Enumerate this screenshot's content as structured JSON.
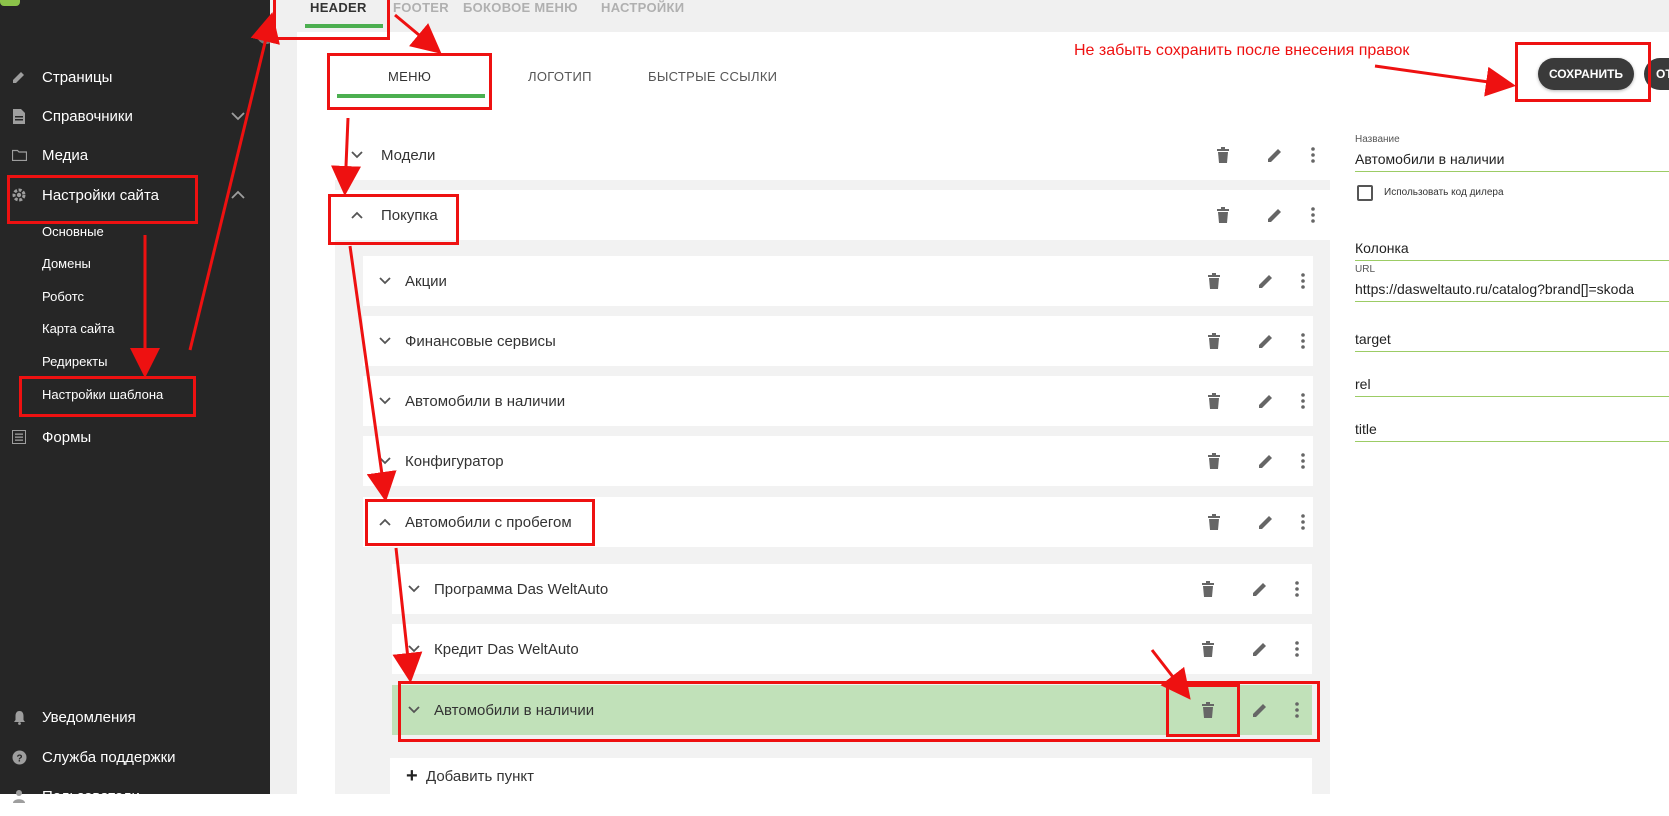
{
  "sidebar": {
    "items": [
      {
        "label": "Страницы",
        "icon": "pencil-icon"
      },
      {
        "label": "Справочники",
        "icon": "document-icon"
      },
      {
        "label": "Медиа",
        "icon": "folder-icon"
      },
      {
        "label": "Настройки сайта",
        "icon": "gear-icon"
      },
      {
        "label": "Формы",
        "icon": "list-icon"
      },
      {
        "label": "Уведомления",
        "icon": "bell-icon"
      },
      {
        "label": "Служба поддержки",
        "icon": "help-icon"
      },
      {
        "label": "Пользователи",
        "icon": "user-icon"
      }
    ],
    "subitems": [
      "Основные",
      "Домены",
      "Роботс",
      "Карта сайта",
      "Редиректы",
      "Настройки шаблона"
    ]
  },
  "top_tabs": [
    "HEADER",
    "FOOTER",
    "БОКОВОЕ МЕНЮ",
    "НАСТРОЙКИ"
  ],
  "inner_tabs": [
    "МЕНЮ",
    "ЛОГОТИП",
    "БЫСТРЫЕ ССЫЛКИ"
  ],
  "annotation_note": "Не забыть сохранить после внесения правок",
  "save_label": "СОХРАНИТЬ",
  "other_label": "ОТ",
  "menu": {
    "level1": [
      "Модели",
      "Покупка"
    ],
    "level2": [
      "Акции",
      "Финансовые сервисы",
      "Автомобили в наличии",
      "Конфигуратор",
      "Автомобили с пробегом"
    ],
    "level3": [
      "Программа Das WeltAuto",
      "Кредит Das WeltAuto",
      "Автомобили в наличии"
    ],
    "add_label": "Добавить пункт"
  },
  "form": {
    "name_label": "Название",
    "name_value": "Автомобили в наличии",
    "dealer_code_label": "Использовать код дилера",
    "column_value": "Колонка",
    "url_label": "URL",
    "url_value": "https://dasweltauto.ru/catalog?brand[]=skoda",
    "target_value": "target",
    "rel_value": "rel",
    "title_value": "title"
  },
  "colors": {
    "accent": "#4caf50",
    "annotation": "#ee1111",
    "highlight": "#c1e1b9",
    "sidebar_bg": "#262626"
  }
}
